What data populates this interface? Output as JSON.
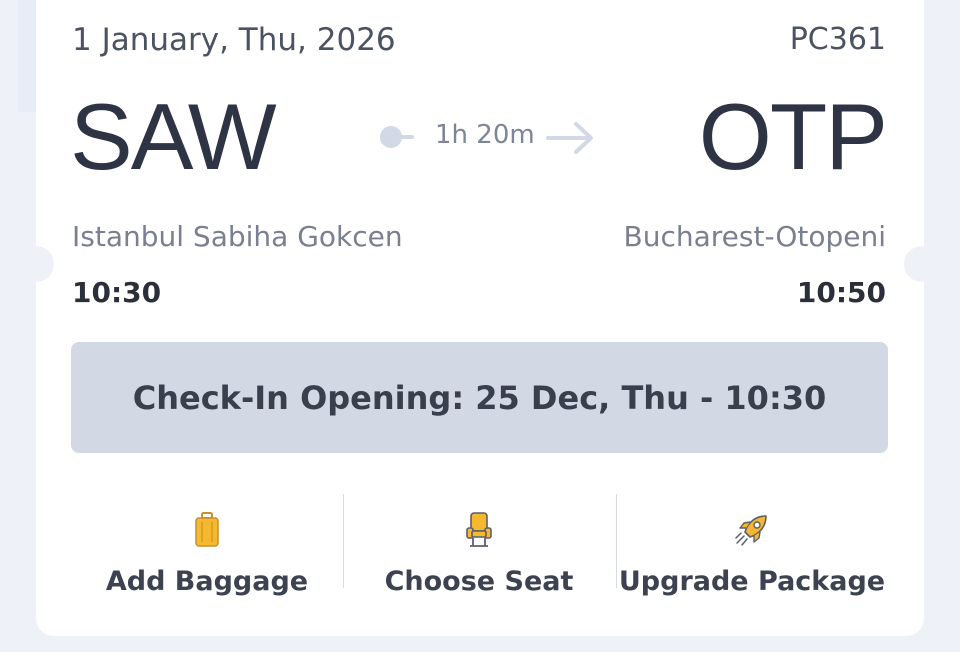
{
  "flight": {
    "date": "1 January, Thu, 2026",
    "number": "PC361",
    "origin": {
      "code": "SAW",
      "city": "Istanbul Sabiha Gokcen",
      "time": "10:30"
    },
    "destination": {
      "code": "OTP",
      "city": "Bucharest-Otopeni",
      "time": "10:50"
    },
    "duration": "1h 20m"
  },
  "checkin": {
    "text": "Check-In Opening: 25 Dec, Thu - 10:30"
  },
  "actions": [
    {
      "label": "Add Baggage",
      "icon": "baggage-icon"
    },
    {
      "label": "Choose Seat",
      "icon": "seat-icon"
    },
    {
      "label": "Upgrade Package",
      "icon": "rocket-icon"
    }
  ],
  "colors": {
    "accent": "#f5b82e",
    "checkin_bg": "#d3d8e5",
    "page_bg": "#eef1f8",
    "text_dark": "#2f3444",
    "text_muted": "#7a8090"
  }
}
